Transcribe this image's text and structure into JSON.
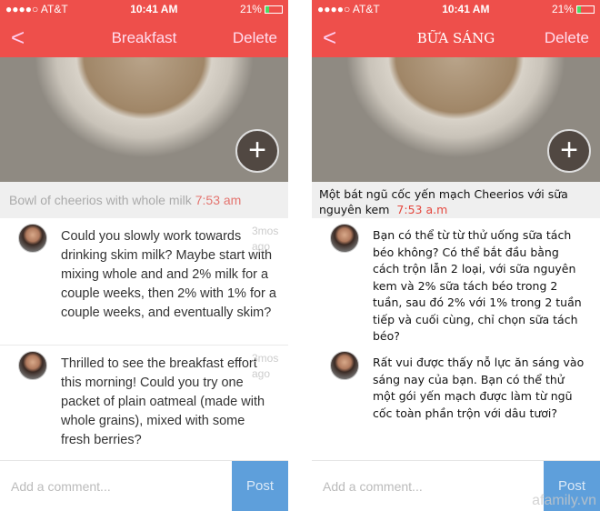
{
  "status": {
    "carrier": "●●●●○ AT&T",
    "time": "10:41 AM",
    "battery": "21%"
  },
  "left": {
    "title": "Breakfast",
    "delete": "Delete",
    "caption": "Bowl of cheerios with whole milk",
    "caption_time": "7:53 am",
    "comments": [
      {
        "text": "Could you slowly work towards drinking skim milk?  Maybe start with mixing whole and and 2% milk for a couple weeks, then 2% with 1% for a couple weeks, and eventually skim?",
        "ago": "3mos ago"
      },
      {
        "text": "Thrilled to see the breakfast effort this morning!  Could you try one packet of plain oatmeal (made with whole grains), mixed with some fresh berries?",
        "ago": "3mos ago"
      }
    ],
    "input_placeholder": "Add a comment...",
    "post": "Post"
  },
  "right": {
    "title": "BỮA SÁNG",
    "delete": "Delete",
    "caption": "Một bát ngũ cốc yến mạch Cheerios với sữa nguyên kem",
    "caption_time": "7:53 a.m",
    "comments": [
      {
        "text": "Bạn có thể từ từ thử uống sữa tách béo không? Có thể bắt đầu bằng cách trộn lẫn 2 loại, với sữa nguyên kem và 2% sữa tách béo trong 2 tuần, sau đó 2% với 1% trong 2 tuần tiếp và cuối cùng, chỉ chọn sữa tách béo?"
      },
      {
        "text": "Rất vui được thấy nỗ lực ăn sáng vào sáng nay của bạn. Bạn có thể thử một gói yến mạch được làm từ ngũ cốc toàn phần trộn với dâu tươi?"
      }
    ],
    "input_placeholder": "Add a comment...",
    "post": "Post"
  },
  "watermark": "afamily.vn",
  "colors": {
    "header": "#ee4f4b",
    "post_button": "#5e9fdb",
    "time_accent": "#e4746f"
  }
}
